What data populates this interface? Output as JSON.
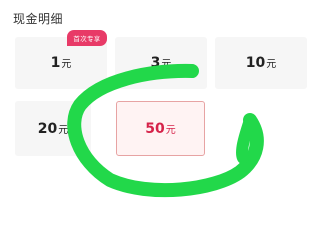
{
  "header": {
    "title": "现金明细"
  },
  "badge": {
    "label": "首次专享"
  },
  "options": [
    {
      "value": "1",
      "unit": "元"
    },
    {
      "value": "3",
      "unit": "元"
    },
    {
      "value": "10",
      "unit": "元"
    },
    {
      "value": "20",
      "unit": "元"
    },
    {
      "value": "50",
      "unit": "元"
    }
  ],
  "selected_option": "50",
  "colors": {
    "accent": "#d6234a",
    "badge": "#e83a67",
    "selected_border": "#e7a3a3",
    "card_bg": "#f6f6f6",
    "annotation": "#22d84a"
  }
}
